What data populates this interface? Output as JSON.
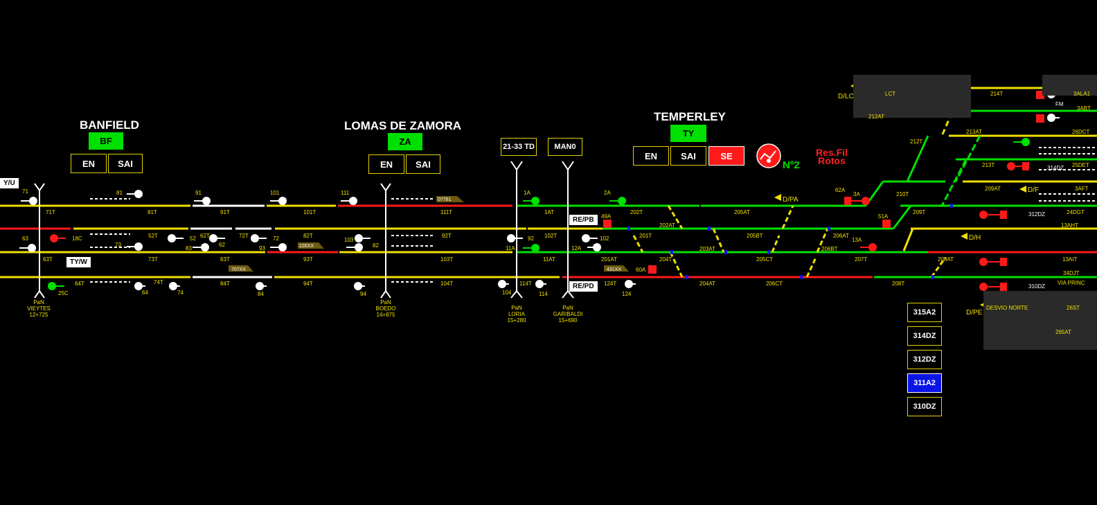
{
  "stations": {
    "banfield": {
      "name": "BANFIELD",
      "code": "BF",
      "btn_en": "EN",
      "btn_sai": "SAI"
    },
    "lomas": {
      "name": "LOMAS DE ZAMORA",
      "code": "ZA",
      "btn_en": "EN",
      "btn_sai": "SAI"
    },
    "temperley": {
      "name": "TEMPERLEY",
      "code": "TY",
      "btn_en": "EN",
      "btn_sai": "SAI",
      "btn_se": "SE"
    }
  },
  "top_buttons": {
    "td": "21-33 TD",
    "man": "MAN0"
  },
  "status": {
    "n2": "Nº2",
    "res_fil_1": "Res.Fil",
    "res_fil_2": "Rotos"
  },
  "tags": {
    "tyu": "Y/U",
    "tyw": "TY/W",
    "repb": "RE/PB",
    "repd": "RE/PD"
  },
  "side_buttons": [
    "315A2",
    "314DZ",
    "312DZ",
    "311A2",
    "310DZ"
  ],
  "crossings": [
    {
      "l1": "PaN",
      "l2": "VIEYTES",
      "l3": "12+725"
    },
    {
      "l1": "PaN",
      "l2": "BOEDO",
      "l3": "14+875"
    },
    {
      "l1": "PaN",
      "l2": "LORIA",
      "l3": "15+280"
    },
    {
      "l1": "PaN",
      "l2": "GARIBALDI",
      "l3": "15+690"
    }
  ],
  "track_labels": {
    "row1": [
      "71T",
      "81T",
      "91T",
      "101T",
      "111T",
      "1AT",
      "202T",
      "205AT",
      "209T",
      "24DGT"
    ],
    "row2": [
      "52T",
      "62T",
      "72T",
      "82T",
      "92T",
      "102T",
      "201T",
      "202AT",
      "205BT",
      "206AT",
      "13AHT"
    ],
    "row3": [
      "63T",
      "73T",
      "83T",
      "93T",
      "103T",
      "11AT",
      "201AT",
      "204T",
      "203AT",
      "205CT",
      "206BT",
      "207T",
      "208AT",
      "13AIT"
    ],
    "row4": [
      "64T",
      "74T",
      "84T",
      "94T",
      "104T",
      "114T",
      "124T",
      "204AT",
      "206CT",
      "208T",
      "34DJT",
      "VIA PRINC"
    ],
    "upper": [
      "LCT",
      "212AT",
      "214T",
      "3ABT",
      "3ALA1",
      "213AT",
      "212T",
      "26DCT",
      "210T",
      "209AT",
      "213T",
      "25DET",
      "3AFT"
    ]
  },
  "signals": [
    "71",
    "81",
    "91",
    "101",
    "111",
    "1A",
    "2A",
    "3A",
    "62A",
    "63",
    "18C",
    "73",
    "83",
    "93",
    "103",
    "82",
    "52",
    "62",
    "72",
    "92",
    "102",
    "11A",
    "12A",
    "49A",
    "51A",
    "13A",
    "25C",
    "64",
    "74",
    "84",
    "94",
    "104",
    "114",
    "124",
    "60A",
    "D/PA",
    "D/H",
    "D/F",
    "D/LC",
    "D/PE",
    "FM",
    "312DZ",
    "310DZ",
    "314DZ",
    "DESVIO NORTE",
    "265AT",
    "26ST"
  ],
  "train_ids": [
    "07761",
    "226XX",
    "707XX",
    "431XX"
  ],
  "colors": {
    "yellow": "#f0e000",
    "red": "#ff1a1a",
    "green": "#00e000",
    "white": "#ffffff",
    "blue": "#0a14e6"
  }
}
